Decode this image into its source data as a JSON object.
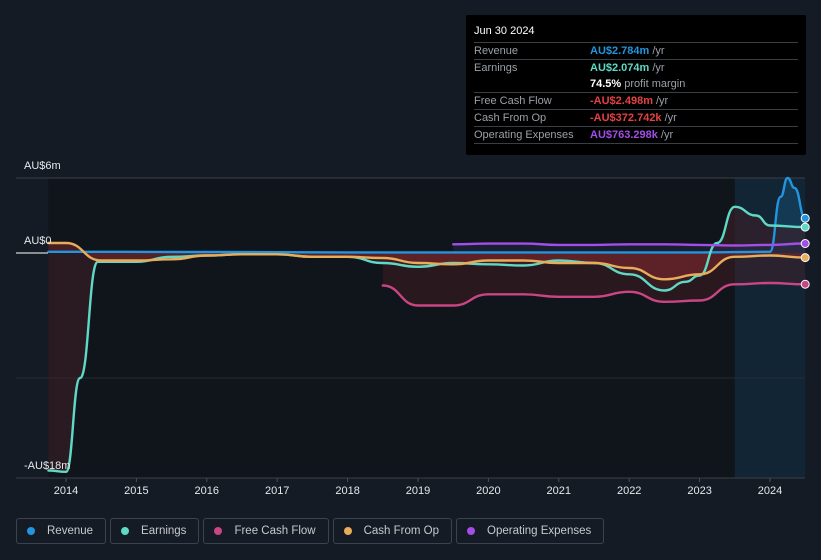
{
  "tooltip": {
    "date": "Jun 30 2024",
    "rows": [
      {
        "label": "Revenue",
        "value": "AU$2.784m",
        "unit": "/yr",
        "color": "#2394df"
      },
      {
        "label": "Earnings",
        "value": "AU$2.074m",
        "unit": "/yr",
        "color": "#5fd8c5"
      },
      {
        "label": "",
        "value": "74.5%",
        "unit": "profit margin",
        "color": "#ffffff"
      },
      {
        "label": "Free Cash Flow",
        "value": "-AU$2.498m",
        "unit": "/yr",
        "color": "#e64141"
      },
      {
        "label": "Cash From Op",
        "value": "-AU$372.742k",
        "unit": "/yr",
        "color": "#e64141"
      },
      {
        "label": "Operating Expenses",
        "value": "AU$763.298k",
        "unit": "/yr",
        "color": "#a24ee8"
      }
    ]
  },
  "legend": [
    {
      "label": "Revenue",
      "color": "#2394df"
    },
    {
      "label": "Earnings",
      "color": "#5fd8c5"
    },
    {
      "label": "Free Cash Flow",
      "color": "#c94584"
    },
    {
      "label": "Cash From Op",
      "color": "#e8ac5a"
    },
    {
      "label": "Operating Expenses",
      "color": "#a24ee8"
    }
  ],
  "chart_data": {
    "type": "line",
    "title": "",
    "xlabel": "",
    "ylabel": "",
    "currency": "AU$",
    "unit": "m",
    "ylim": [
      -18,
      6
    ],
    "xlim": [
      2013.7,
      2024.5
    ],
    "y_tick_labels": [
      {
        "value": 6,
        "label": "AU$6m"
      },
      {
        "value": 0,
        "label": "AU$0"
      },
      {
        "value": -18,
        "label": "-AU$18m"
      }
    ],
    "x_tick_labels": [
      "2014",
      "2015",
      "2016",
      "2017",
      "2018",
      "2019",
      "2020",
      "2021",
      "2022",
      "2023",
      "2024"
    ],
    "x_ticks": [
      2014,
      2015,
      2016,
      2017,
      2018,
      2019,
      2020,
      2021,
      2022,
      2023,
      2024
    ],
    "highlight_range": [
      2023.5,
      2024.5
    ],
    "grid": true,
    "legend_position": "bottom",
    "series": [
      {
        "name": "Revenue",
        "color": "#2394df",
        "points": [
          [
            2013.75,
            0.1
          ],
          [
            2014.5,
            0.1
          ],
          [
            2016,
            0.08
          ],
          [
            2018,
            0.05
          ],
          [
            2020,
            0.05
          ],
          [
            2022,
            0.05
          ],
          [
            2023,
            0.05
          ],
          [
            2024,
            0.1
          ],
          [
            2024.15,
            4.5
          ],
          [
            2024.25,
            6.0
          ],
          [
            2024.35,
            5.2
          ],
          [
            2024.5,
            2.78
          ]
        ]
      },
      {
        "name": "Earnings",
        "color": "#5fd8c5",
        "points": [
          [
            2013.75,
            -17.4
          ],
          [
            2014.0,
            -17.5
          ],
          [
            2014.2,
            -10
          ],
          [
            2014.45,
            -0.7
          ],
          [
            2015,
            -0.7
          ],
          [
            2015.5,
            -0.3
          ],
          [
            2016,
            -0.2
          ],
          [
            2016.5,
            -0.1
          ],
          [
            2017,
            -0.1
          ],
          [
            2017.5,
            -0.3
          ],
          [
            2018,
            -0.3
          ],
          [
            2018.5,
            -0.8
          ],
          [
            2019,
            -1.1
          ],
          [
            2019.5,
            -0.8
          ],
          [
            2020,
            -0.9
          ],
          [
            2020.5,
            -1.0
          ],
          [
            2021,
            -0.6
          ],
          [
            2021.5,
            -0.8
          ],
          [
            2022,
            -1.7
          ],
          [
            2022.5,
            -3.0
          ],
          [
            2022.8,
            -2.3
          ],
          [
            2023.0,
            -1.8
          ],
          [
            2023.25,
            0.8
          ],
          [
            2023.5,
            3.7
          ],
          [
            2023.8,
            3.0
          ],
          [
            2024,
            2.2
          ],
          [
            2024.5,
            2.07
          ]
        ]
      },
      {
        "name": "Free Cash Flow",
        "color": "#c94584",
        "points": [
          [
            2018.5,
            -2.6
          ],
          [
            2019,
            -4.2
          ],
          [
            2019.5,
            -4.2
          ],
          [
            2020,
            -3.3
          ],
          [
            2020.5,
            -3.3
          ],
          [
            2021,
            -3.5
          ],
          [
            2021.5,
            -3.5
          ],
          [
            2022,
            -3.1
          ],
          [
            2022.5,
            -3.9
          ],
          [
            2023,
            -3.8
          ],
          [
            2023.5,
            -2.5
          ],
          [
            2024,
            -2.4
          ],
          [
            2024.5,
            -2.5
          ]
        ]
      },
      {
        "name": "Cash From Op",
        "color": "#e8ac5a",
        "points": [
          [
            2013.75,
            0.8
          ],
          [
            2014.0,
            0.8
          ],
          [
            2014.5,
            -0.6
          ],
          [
            2015,
            -0.6
          ],
          [
            2015.5,
            -0.5
          ],
          [
            2016,
            -0.2
          ],
          [
            2016.5,
            -0.1
          ],
          [
            2017,
            -0.1
          ],
          [
            2017.5,
            -0.3
          ],
          [
            2018,
            -0.3
          ],
          [
            2018.5,
            -0.4
          ],
          [
            2019,
            -0.8
          ],
          [
            2019.5,
            -0.9
          ],
          [
            2020,
            -0.6
          ],
          [
            2020.5,
            -0.6
          ],
          [
            2021,
            -0.8
          ],
          [
            2021.5,
            -0.8
          ],
          [
            2022,
            -1.2
          ],
          [
            2022.5,
            -2.1
          ],
          [
            2023,
            -1.7
          ],
          [
            2023.5,
            -0.3
          ],
          [
            2024,
            -0.2
          ],
          [
            2024.5,
            -0.37
          ]
        ]
      },
      {
        "name": "Operating Expenses",
        "color": "#a24ee8",
        "points": [
          [
            2019.5,
            0.7
          ],
          [
            2020,
            0.75
          ],
          [
            2020.5,
            0.75
          ],
          [
            2021,
            0.65
          ],
          [
            2021.5,
            0.65
          ],
          [
            2022,
            0.7
          ],
          [
            2022.5,
            0.7
          ],
          [
            2023,
            0.65
          ],
          [
            2023.5,
            0.6
          ],
          [
            2024,
            0.65
          ],
          [
            2024.5,
            0.76
          ]
        ]
      }
    ]
  }
}
